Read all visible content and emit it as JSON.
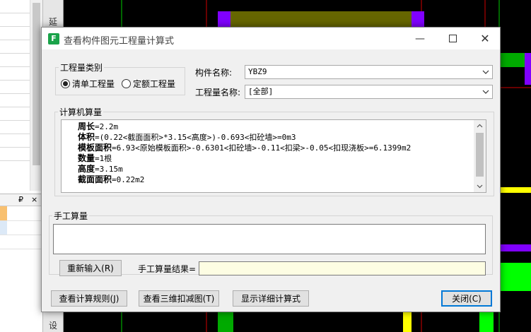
{
  "dialog": {
    "title": "查看构件图元工程量计算式",
    "icon_label": "F",
    "controls": {
      "minimize": "—",
      "close": "✕"
    }
  },
  "quantity_type": {
    "legend": "工程量类别",
    "options": [
      {
        "label": "清单工程量",
        "selected": true
      },
      {
        "label": "定额工程量",
        "selected": false
      }
    ]
  },
  "component": {
    "label": "构件名称:",
    "value": "YBZ9"
  },
  "quantity_name": {
    "label": "工程量名称:",
    "value": "[全部]"
  },
  "computer_calc": {
    "legend": "计算机算量",
    "lines": [
      {
        "name": "周长",
        "expr": "=2.2m"
      },
      {
        "name": "体积",
        "expr": "=(0.22<截面面积>*3.15<高度>)-0.693<扣砼墙>=0m3"
      },
      {
        "name": "模板面积",
        "expr": "=6.93<原始模板面积>-0.6301<扣砼墙>-0.11<扣梁>-0.05<扣现浇板>=6.1399m2"
      },
      {
        "name": "数量",
        "expr": "=1根"
      },
      {
        "name": "高度",
        "expr": "=3.15m"
      },
      {
        "name": "截面面积",
        "expr": "=0.22m2"
      }
    ]
  },
  "manual_calc": {
    "legend": "手工算量",
    "input_value": "",
    "reenter_button": "重新输入(R)",
    "result_label": "手工算量结果=",
    "result_value": ""
  },
  "buttons": {
    "view_rules": "查看计算规则(J)",
    "view_3d": "查看三维扣减图(T)",
    "show_detail": "显示详细计算式",
    "close": "关闭(C)"
  },
  "background": {
    "sidebar_top_label": "延",
    "sidebar_bottom_label": "设",
    "panel_pin": "₽",
    "panel_close": "×"
  },
  "colors": {
    "accent_green": "#1aa34a",
    "cad_yellow": "#ffff00",
    "cad_green": "#00cc00",
    "cad_purple": "#8000ff",
    "cad_olive": "#666600",
    "cad_red": "#d00000"
  }
}
